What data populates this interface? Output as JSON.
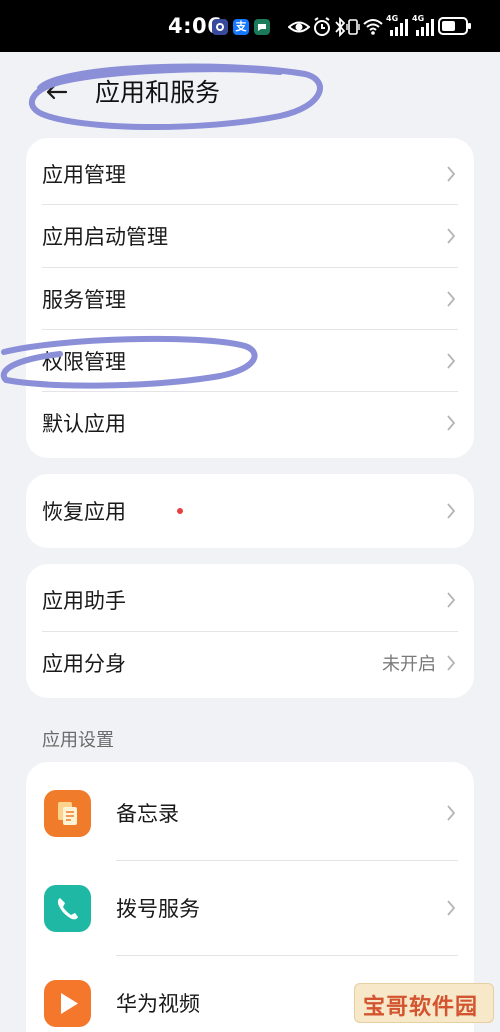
{
  "status_bar": {
    "time": "4:06",
    "notif_icons": [
      "browser-icon",
      "alipay-icon",
      "chat-icon"
    ],
    "alipay_glyph": "支",
    "right_icons": [
      "eye-icon",
      "alarm-icon",
      "bluetooth-icon",
      "vibrate-icon",
      "wifi-icon",
      "signal-4g-icon",
      "signal-4g-icon",
      "battery-icon"
    ],
    "net_label_1": "4G",
    "net_label_2": "4G"
  },
  "header": {
    "title": "应用和服务",
    "back_icon": "back-arrow-icon"
  },
  "group1": {
    "items": [
      {
        "label": "应用管理"
      },
      {
        "label": "应用启动管理"
      },
      {
        "label": "服务管理"
      },
      {
        "label": "权限管理"
      },
      {
        "label": "默认应用"
      }
    ]
  },
  "group2": {
    "items": [
      {
        "label": "恢复应用",
        "badge": "red-dot"
      }
    ]
  },
  "group3": {
    "items": [
      {
        "label": "应用助手"
      },
      {
        "label": "应用分身",
        "value": "未开启"
      }
    ]
  },
  "app_settings": {
    "section_title": "应用设置",
    "items": [
      {
        "label": "备忘录",
        "icon": "memo-icon",
        "color": "#f07b2a"
      },
      {
        "label": "拨号服务",
        "icon": "phone-icon",
        "color": "#1fb8a4"
      },
      {
        "label": "华为视频",
        "icon": "video-play-icon",
        "color": "#f4772b"
      }
    ]
  },
  "watermark": {
    "text": "宝哥软件园"
  },
  "colors": {
    "background": "#f1f2f6",
    "card": "#ffffff",
    "annotation": "#8a8fd8",
    "badge": "#e84040"
  }
}
